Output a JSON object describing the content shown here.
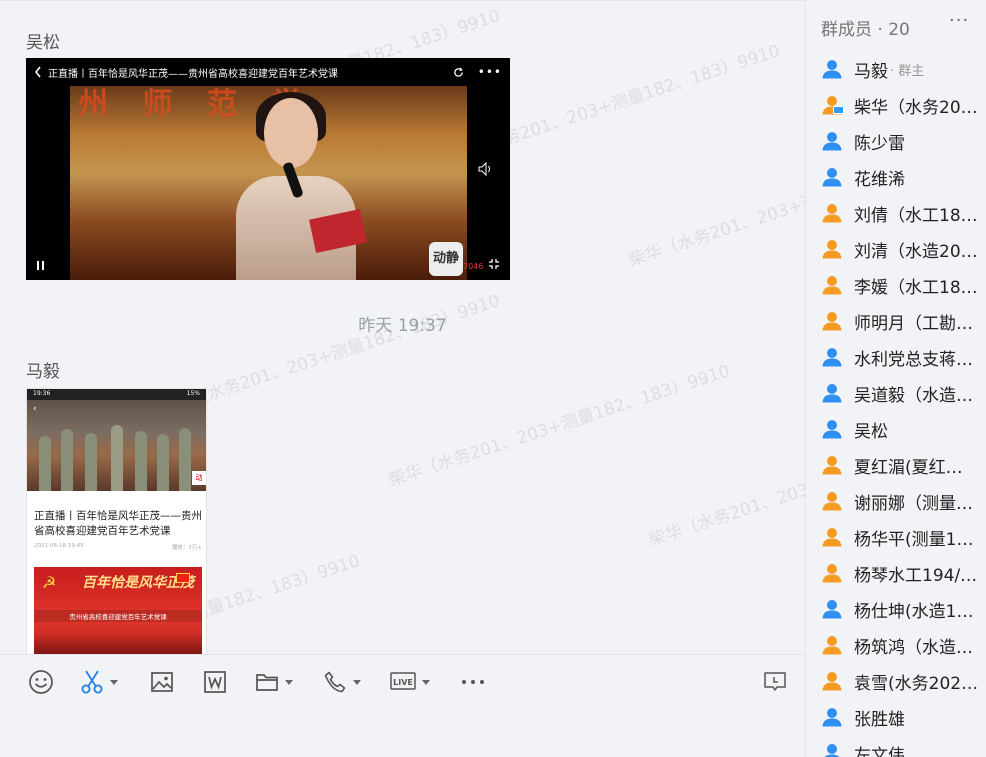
{
  "chat": {
    "messages": [
      {
        "sender": "吴松",
        "video": {
          "title": "正直播丨百年恰是风华正茂——贵州省高校喜迎建党百年艺术党课",
          "stage_banner": "州 师 范 学",
          "logo_text": "动静",
          "view_count": "7046"
        }
      },
      {
        "sender": "马毅",
        "screenshot": {
          "time": "19:36",
          "battery": "15%",
          "title": "正直播丨百年恰是风华正茂——贵州省高校喜迎建党百年艺术党课",
          "date": "2021-06-18 19:45",
          "views": "播放：7万+",
          "poster_headline": "百年恰是风华正茂",
          "poster_subtitle": "贵州省高校喜迎建党百年艺术党课"
        }
      }
    ],
    "timestamp": "昨天 19:37",
    "watermark": "柴华（水务201、203+测量182、183）9910"
  },
  "toolbar": {
    "icons": [
      "emoji-icon",
      "scissors-icon",
      "image-icon",
      "word-icon",
      "folder-icon",
      "phone-icon",
      "live-icon",
      "more-icon",
      "chat-history-icon"
    ]
  },
  "members": {
    "header": "群成员 · 20",
    "more_label": "···",
    "list": [
      {
        "name": "马毅",
        "role": "· 群主",
        "color": "#2f8ff3"
      },
      {
        "name": "柴华（水务201、203+测量182、183）9910",
        "role": "",
        "color": "#f59a23"
      },
      {
        "name": "陈少雷",
        "role": "",
        "color": "#2f8ff3"
      },
      {
        "name": "花维浠",
        "role": "",
        "color": "#2f8ff3"
      },
      {
        "name": "刘倩（水工18…",
        "role": "",
        "color": "#f59a23"
      },
      {
        "name": "刘清（水造20…",
        "role": "",
        "color": "#f59a23"
      },
      {
        "name": "李媛（水工18…",
        "role": "",
        "color": "#f59a23"
      },
      {
        "name": "师明月（工勘…",
        "role": "",
        "color": "#f59a23"
      },
      {
        "name": "水利党总支蒋…",
        "role": "",
        "color": "#2f8ff3"
      },
      {
        "name": "吴道毅（水造…",
        "role": "",
        "color": "#2f8ff3"
      },
      {
        "name": "吴松",
        "role": "",
        "color": "#2f8ff3"
      },
      {
        "name": "夏红湄(夏红…",
        "role": "",
        "color": "#f59a23"
      },
      {
        "name": "谢丽娜（测量…",
        "role": "",
        "color": "#f59a23"
      },
      {
        "name": "杨华平(测量1…",
        "role": "",
        "color": "#f59a23"
      },
      {
        "name": "杨琴水工194/…",
        "role": "",
        "color": "#f59a23"
      },
      {
        "name": "杨仕坤(水造1…",
        "role": "",
        "color": "#2f8ff3"
      },
      {
        "name": "杨筑鸿（水造…",
        "role": "",
        "color": "#f59a23"
      },
      {
        "name": "袁雪(水务202…",
        "role": "",
        "color": "#f59a23"
      },
      {
        "name": "张胜雄",
        "role": "",
        "color": "#2f8ff3"
      },
      {
        "name": "左文伟",
        "role": "",
        "color": "#2f8ff3"
      }
    ]
  }
}
